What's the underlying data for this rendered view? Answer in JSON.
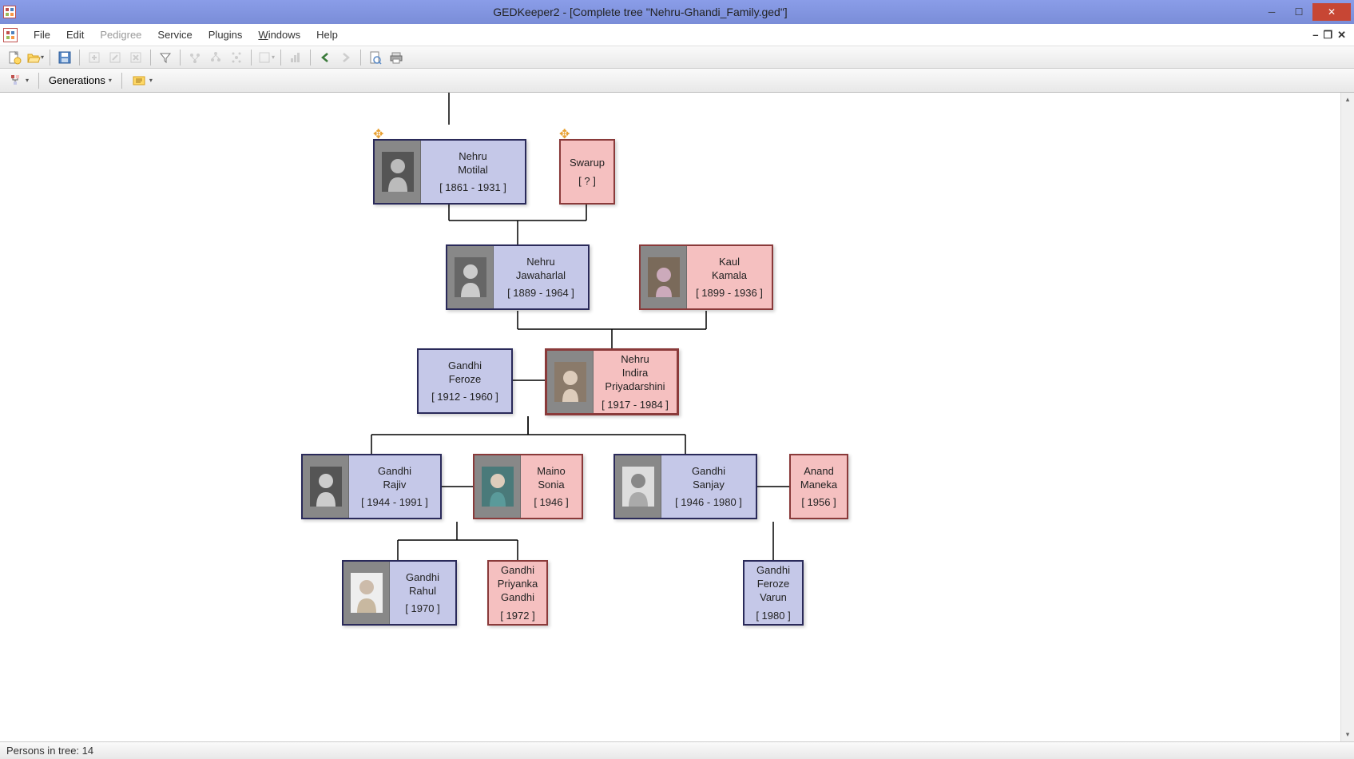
{
  "title": "GEDKeeper2 - [Complete tree \"Nehru-Ghandi_Family.ged\"]",
  "menu": {
    "file": "File",
    "edit": "Edit",
    "pedigree": "Pedigree",
    "service": "Service",
    "plugins": "Plugins",
    "windows": "Windows",
    "help": "Help"
  },
  "subtoolbar": {
    "generations": "Generations"
  },
  "status": "Persons in tree: 14",
  "people": {
    "motilal": {
      "surname": "Nehru",
      "given": "Motilal",
      "dates": "[ 1861 - 1931 ]"
    },
    "swarup": {
      "surname": "Swarup",
      "given": "",
      "dates": "[ ? ]"
    },
    "jawaharlal": {
      "surname": "Nehru",
      "given": "Jawaharlal",
      "dates": "[ 1889 - 1964 ]"
    },
    "kamala": {
      "surname": "Kaul",
      "given": "Kamala",
      "dates": "[ 1899 - 1936 ]"
    },
    "feroze": {
      "surname": "Gandhi",
      "given": "Feroze",
      "dates": "[ 1912 - 1960 ]"
    },
    "indira": {
      "surname": "Nehru",
      "given": "Indira",
      "given2": "Priyadarshini",
      "dates": "[ 1917 - 1984 ]"
    },
    "rajiv": {
      "surname": "Gandhi",
      "given": "Rajiv",
      "dates": "[ 1944 - 1991 ]"
    },
    "sonia": {
      "surname": "Maino",
      "given": "Sonia",
      "dates": "[ 1946 ]"
    },
    "sanjay": {
      "surname": "Gandhi",
      "given": "Sanjay",
      "dates": "[ 1946 - 1980 ]"
    },
    "maneka": {
      "surname": "Anand",
      "given": "Maneka",
      "dates": "[ 1956 ]"
    },
    "rahul": {
      "surname": "Gandhi",
      "given": "Rahul",
      "dates": "[ 1970 ]"
    },
    "priyanka": {
      "surname": "Gandhi",
      "given": "Priyanka",
      "given2": "Gandhi",
      "dates": "[ 1972 ]"
    },
    "varun": {
      "surname": "Gandhi",
      "given": "Feroze",
      "given2": "Varun",
      "dates": "[ 1980 ]"
    }
  }
}
